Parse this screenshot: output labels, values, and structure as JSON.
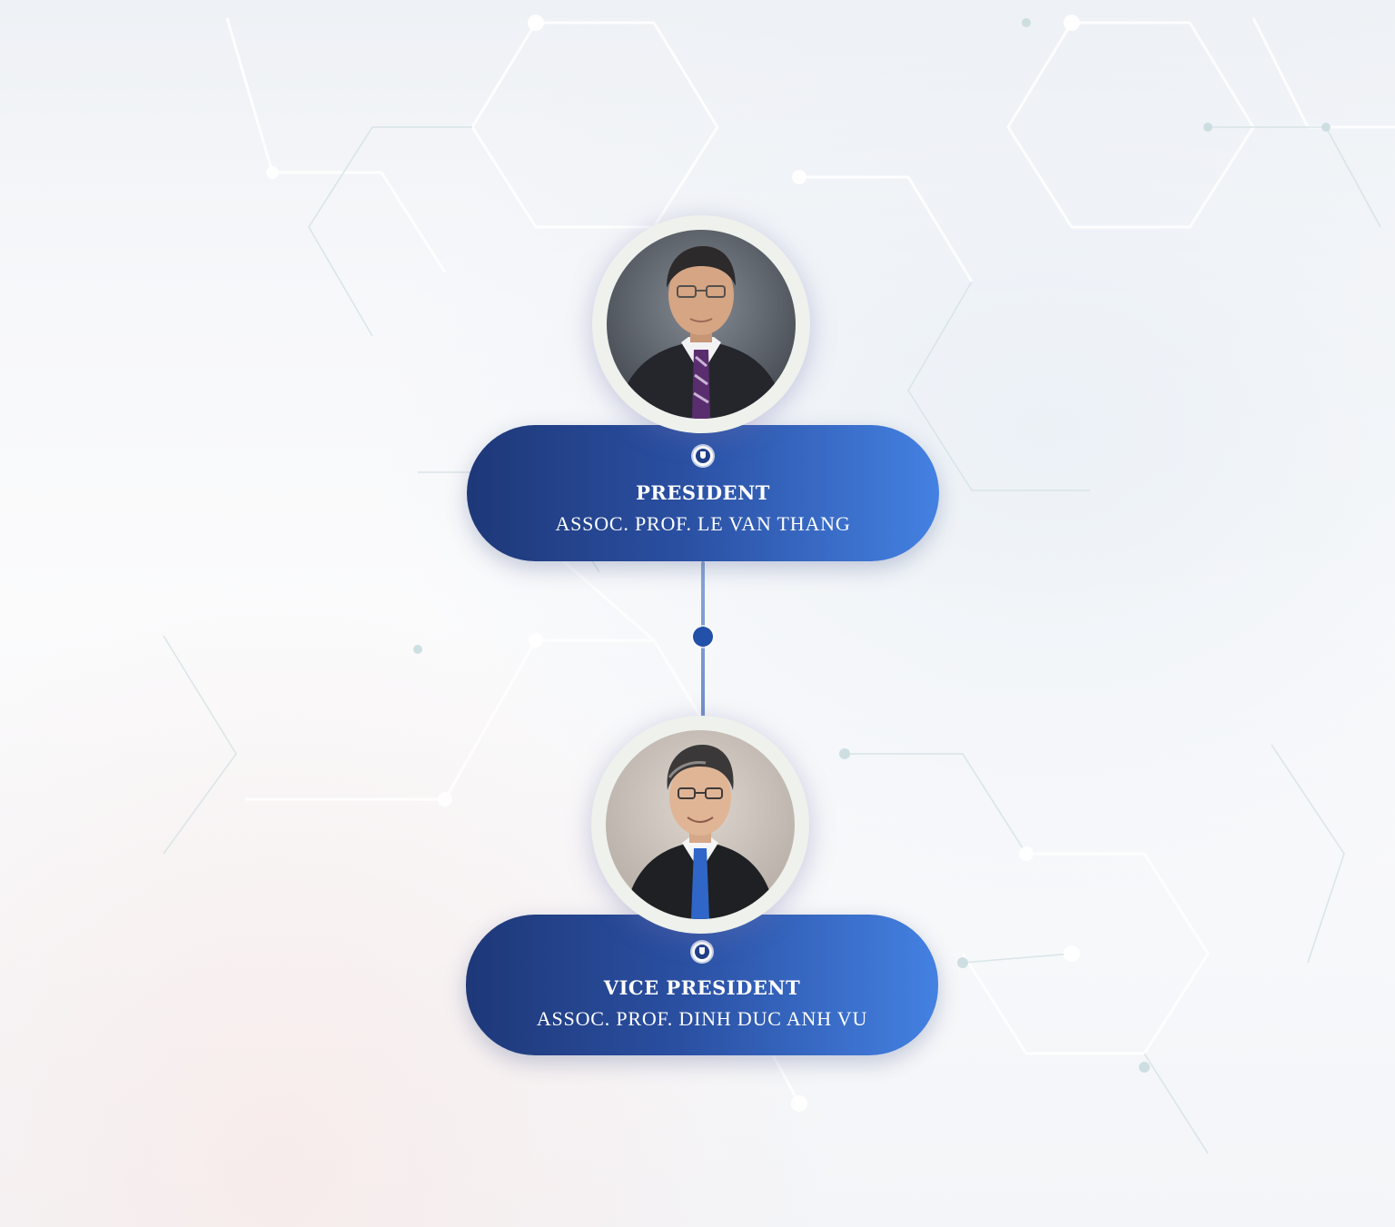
{
  "colors": {
    "card_gradient_start": "#1e3878",
    "card_gradient_end": "#4481e2",
    "connector_dot": "#2350a8",
    "avatar_ring": "#eef1ec"
  },
  "nodes": [
    {
      "role": "PRESIDENT",
      "name": "ASSOC. PROF. LE VAN THANG",
      "emblem_icon": "university-emblem-icon",
      "portrait": "portrait-photo"
    },
    {
      "role": "VICE PRESIDENT",
      "name": "ASSOC. PROF. DINH DUC ANH VU",
      "emblem_icon": "university-emblem-icon",
      "portrait": "portrait-photo"
    }
  ]
}
